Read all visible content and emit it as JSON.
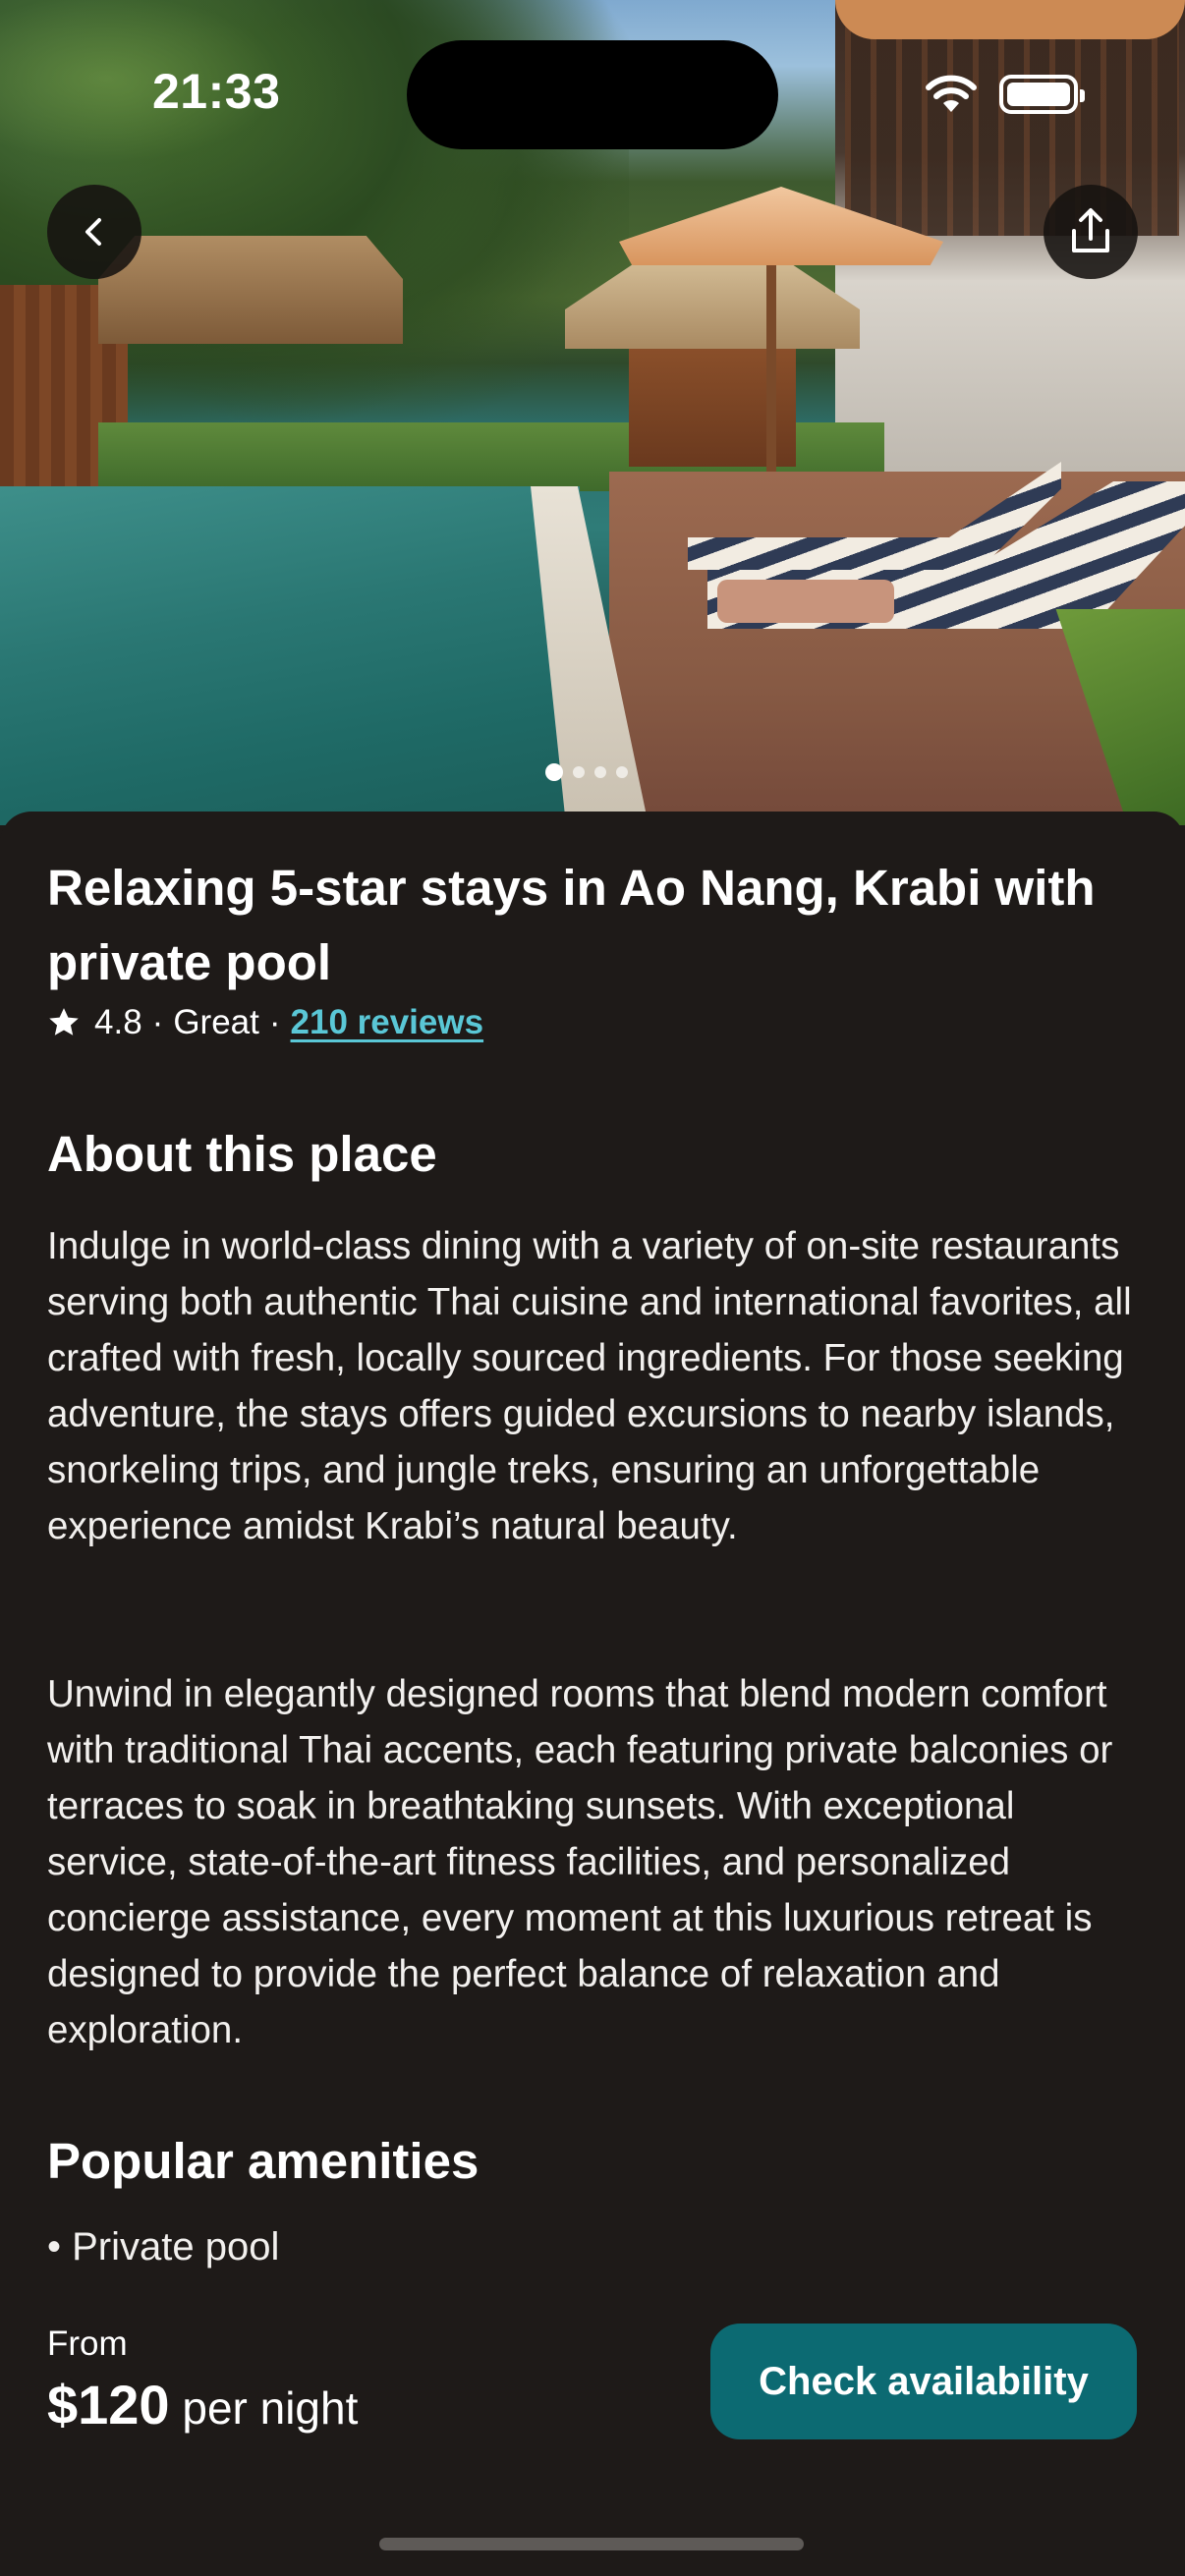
{
  "status_bar": {
    "time": "21:33"
  },
  "hero": {
    "image": "Resort pool with lounge chairs, thatched huts and palm trees",
    "active_slide": 1,
    "total_slides": 4
  },
  "icons": {
    "back": "chevron-left-icon",
    "share": "share-icon",
    "star": "star-icon",
    "wifi": "wifi-icon",
    "battery": "battery-icon"
  },
  "listing": {
    "title": "Relaxing 5-star stays in Ao Nang, Krabi with private pool",
    "rating": "4.8",
    "rating_label": "Great",
    "reviews_link": "210 reviews"
  },
  "about": {
    "heading": "About this place",
    "paragraph1": "Indulge in world-class dining with a variety of on-site restaurants serving both authentic Thai cuisine and international favorites, all crafted with fresh, locally sourced ingredients. For those seeking adventure, the stays offers guided excursions to nearby islands, snorkeling trips, and jungle treks, ensuring an unforgettable experience amidst Krabi’s natural beauty.",
    "paragraph2": "Unwind in elegantly designed rooms that blend modern comfort with traditional Thai accents, each featuring private balconies or terraces to soak in breathtaking sunsets. With exceptional service, state-of-the-art fitness facilities, and personalized concierge assistance, every moment at this luxurious retreat is designed to provide the perfect balance of relaxation and exploration."
  },
  "amenities": {
    "heading": "Popular amenities",
    "items": [
      "• Private pool"
    ]
  },
  "booking": {
    "from_label": "From",
    "price": "$120",
    "price_unit": " per night",
    "cta_label": "Check availability"
  },
  "colors": {
    "background": "#1e1a18",
    "accent_link": "#5ac7d6",
    "cta_background": "#0c6a72"
  }
}
